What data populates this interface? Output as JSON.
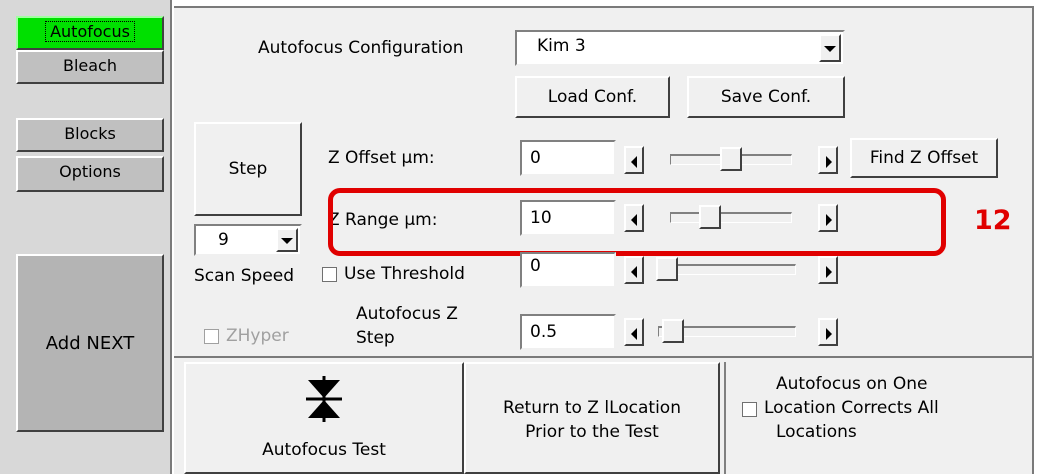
{
  "tabs": [
    {
      "label": "Autofocus",
      "active": true
    },
    {
      "label": "Bleach",
      "active": false
    },
    {
      "label": "Blocks",
      "active": false
    },
    {
      "label": "Options",
      "active": false
    }
  ],
  "add_next_label": "Add NEXT",
  "autofocus_config": {
    "label": "Autofocus Configuration",
    "value": "Kim 3"
  },
  "load_conf_label": "Load Conf.",
  "save_conf_label": "Save Conf.",
  "step_button_label": "Step",
  "step_select_value": "9",
  "scan_speed_label": "Scan Speed",
  "use_threshold": {
    "label": "Use Threshold",
    "checked": false
  },
  "zhyper": {
    "label": "ZHyper",
    "checked": false,
    "disabled": true
  },
  "z_offset": {
    "label": "Z Offset µm:",
    "value": "0",
    "slider_fraction": 0.5
  },
  "find_z_offset_label": "Find Z Offset",
  "z_range": {
    "label": "Z Range µm:",
    "value": "10",
    "slider_fraction": 0.3
  },
  "threshold_value": {
    "value": "0",
    "slider_fraction": 0.0
  },
  "af_z_step": {
    "label_line1": "Autofocus Z",
    "label_line2": "Step",
    "value": "0.5",
    "slider_fraction": 0.05
  },
  "autofocus_test_label": "Autofocus Test",
  "return_button": {
    "line1": "Return to Z lLocation",
    "line2": "Prior to the Test"
  },
  "one_location": {
    "line1": "Autofocus on One",
    "line2": "Location Corrects All",
    "line3": "Locations",
    "checked": false
  },
  "annotation": {
    "number": "12",
    "color": "#e00000"
  },
  "colors": {
    "active_tab": "#00e000",
    "face": "#f0f0f0",
    "dark_face": "#b8b8b8",
    "highlight_box": "#e00000"
  }
}
